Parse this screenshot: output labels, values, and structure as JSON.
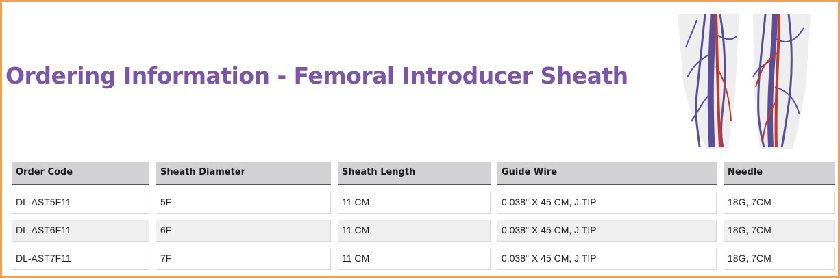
{
  "page": {
    "title": "Ordering Information - Femoral Introducer Sheath",
    "illustration": "legs-veins-illustration",
    "colors": {
      "title": "#7b55a8",
      "border": "#f0a050",
      "header_bg": "#d2d2d4",
      "alt_row_bg": "#efefef",
      "vein": "#5a4e9a",
      "artery": "#c8382a"
    }
  },
  "table": {
    "columns": [
      "Order Code",
      "Sheath Diameter",
      "Sheath Length",
      "Guide Wire",
      "Needle"
    ],
    "rows": [
      [
        "DL-AST5F11",
        "5F",
        "11 CM",
        "0.038\" X 45 CM, J TIP",
        "18G, 7CM"
      ],
      [
        "DL-AST6F11",
        "6F",
        "11 CM",
        "0.038\" X 45 CM, J TIP",
        "18G, 7CM"
      ],
      [
        "DL-AST7F11",
        "7F",
        "11 CM",
        "0.038\" X 45 CM, J TIP",
        "18G, 7CM"
      ]
    ]
  }
}
